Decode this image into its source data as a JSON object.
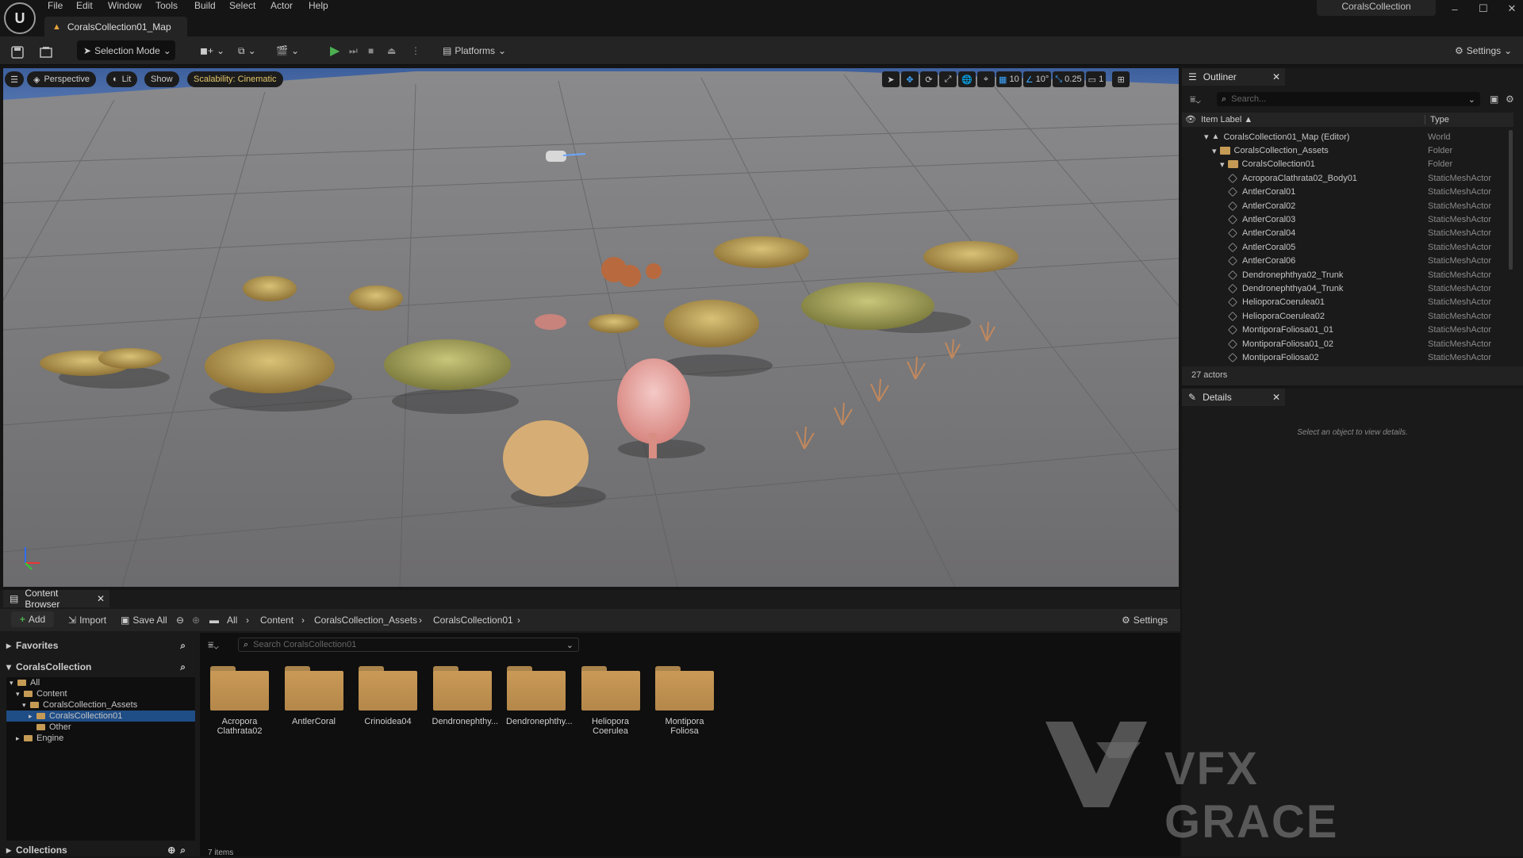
{
  "menu": [
    "File",
    "Edit",
    "Window",
    "Tools",
    "Build",
    "Select",
    "Actor",
    "Help"
  ],
  "map_tab": "CoralsCollection01_Map",
  "project_name": "CoralsCollection",
  "toolbar": {
    "selection_mode": "Selection Mode",
    "platforms": "Platforms",
    "settings": "Settings"
  },
  "viewport": {
    "perspective": "Perspective",
    "lit": "Lit",
    "show": "Show",
    "scalability": "Scalability: Cinematic",
    "grid_snap": "10",
    "rot_snap": "10°",
    "scale_snap": "0.25",
    "camera_speed": "1"
  },
  "outliner": {
    "title": "Outliner",
    "search_placeholder": "Search...",
    "col_label": "Item Label ▲",
    "col_type": "Type",
    "rows": [
      {
        "label": "CoralsCollection01_Map (Editor)",
        "type": "World",
        "depth": 0,
        "kind": "world"
      },
      {
        "label": "CoralsCollection_Assets",
        "type": "Folder",
        "depth": 1,
        "kind": "folder"
      },
      {
        "label": "CoralsCollection01",
        "type": "Folder",
        "depth": 2,
        "kind": "folder"
      },
      {
        "label": "AcroporaClathrata02_Body01",
        "type": "StaticMeshActor",
        "depth": 3,
        "kind": "mesh"
      },
      {
        "label": "AntlerCoral01",
        "type": "StaticMeshActor",
        "depth": 3,
        "kind": "mesh"
      },
      {
        "label": "AntlerCoral02",
        "type": "StaticMeshActor",
        "depth": 3,
        "kind": "mesh"
      },
      {
        "label": "AntlerCoral03",
        "type": "StaticMeshActor",
        "depth": 3,
        "kind": "mesh"
      },
      {
        "label": "AntlerCoral04",
        "type": "StaticMeshActor",
        "depth": 3,
        "kind": "mesh"
      },
      {
        "label": "AntlerCoral05",
        "type": "StaticMeshActor",
        "depth": 3,
        "kind": "mesh"
      },
      {
        "label": "AntlerCoral06",
        "type": "StaticMeshActor",
        "depth": 3,
        "kind": "mesh"
      },
      {
        "label": "Dendronephthya02_Trunk",
        "type": "StaticMeshActor",
        "depth": 3,
        "kind": "mesh"
      },
      {
        "label": "Dendronephthya04_Trunk",
        "type": "StaticMeshActor",
        "depth": 3,
        "kind": "mesh"
      },
      {
        "label": "HelioporaCoerulea01",
        "type": "StaticMeshActor",
        "depth": 3,
        "kind": "mesh"
      },
      {
        "label": "HelioporaCoerulea02",
        "type": "StaticMeshActor",
        "depth": 3,
        "kind": "mesh"
      },
      {
        "label": "MontiporaFoliosa01_01",
        "type": "StaticMeshActor",
        "depth": 3,
        "kind": "mesh"
      },
      {
        "label": "MontiporaFoliosa01_02",
        "type": "StaticMeshActor",
        "depth": 3,
        "kind": "mesh"
      },
      {
        "label": "MontiporaFoliosa02",
        "type": "StaticMeshActor",
        "depth": 3,
        "kind": "mesh"
      }
    ],
    "actor_count": "27 actors"
  },
  "details": {
    "title": "Details",
    "empty_message": "Select an object to view details."
  },
  "content_browser": {
    "tab": "Content Browser",
    "add": "Add",
    "import": "Import",
    "save_all": "Save All",
    "settings": "Settings",
    "breadcrumb": [
      "All",
      "Content",
      "CoralsCollection_Assets",
      "CoralsCollection01"
    ],
    "favorites": "Favorites",
    "collection_root": "CoralsCollection",
    "collections": "Collections",
    "search_placeholder": "Search CoralsCollection01",
    "tree": [
      {
        "label": "All",
        "depth": 0,
        "selected": false
      },
      {
        "label": "Content",
        "depth": 1,
        "selected": false
      },
      {
        "label": "CoralsCollection_Assets",
        "depth": 2,
        "selected": false
      },
      {
        "label": "CoralsCollection01",
        "depth": 3,
        "selected": true
      },
      {
        "label": "Other",
        "depth": 3,
        "selected": false
      },
      {
        "label": "Engine",
        "depth": 1,
        "selected": false
      }
    ],
    "folders": [
      "Acropora Clathrata02",
      "AntlerCoral",
      "Crinoidea04",
      "Dendronephthy...",
      "Dendronephthy...",
      "Heliopora Coerulea",
      "Montipora Foliosa"
    ],
    "item_count": "7 items"
  },
  "watermark": "VFX GRACE",
  "colors": {
    "accent_blue": "#3ea6ff",
    "play_green": "#4caf50",
    "folder": "#c49a55",
    "scalability": "#e3c66a"
  }
}
